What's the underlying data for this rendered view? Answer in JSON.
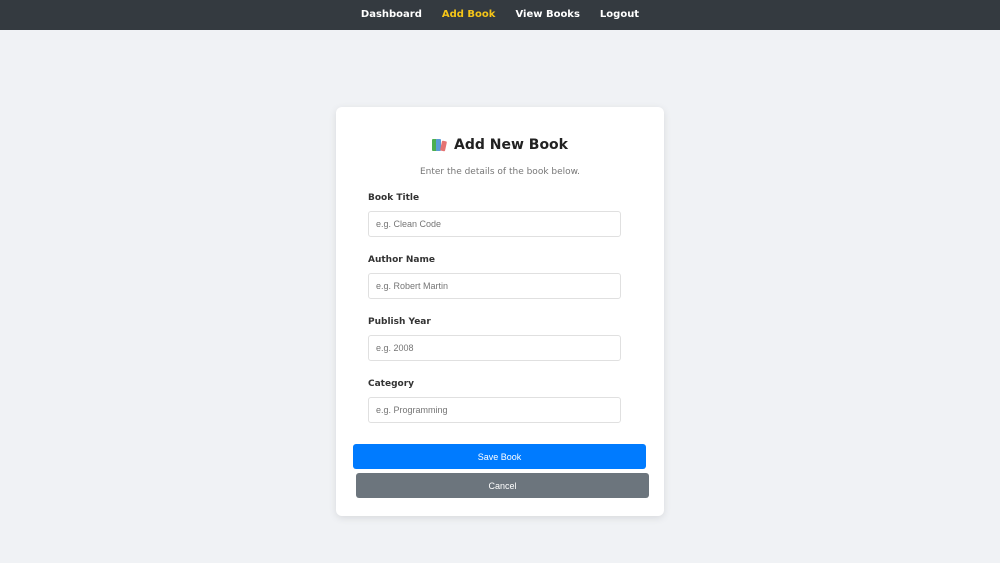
{
  "nav": {
    "items": [
      {
        "label": "Dashboard",
        "active": false
      },
      {
        "label": "Add Book",
        "active": true
      },
      {
        "label": "View Books",
        "active": false
      },
      {
        "label": "Logout",
        "active": false
      }
    ],
    "active_color": "#f5c518",
    "background": "#343a40"
  },
  "form": {
    "icon": "books-icon",
    "title": "Add New Book",
    "subtitle": "Enter the details of the book below.",
    "fields": [
      {
        "label": "Book Title",
        "placeholder": "e.g. Clean Code",
        "value": ""
      },
      {
        "label": "Author Name",
        "placeholder": "e.g. Robert Martin",
        "value": ""
      },
      {
        "label": "Publish Year",
        "placeholder": "e.g. 2008",
        "value": ""
      },
      {
        "label": "Category",
        "placeholder": "e.g. Programming",
        "value": ""
      }
    ],
    "save_label": "Save Book",
    "cancel_label": "Cancel",
    "save_color": "#007bff",
    "cancel_color": "#6c757d"
  }
}
